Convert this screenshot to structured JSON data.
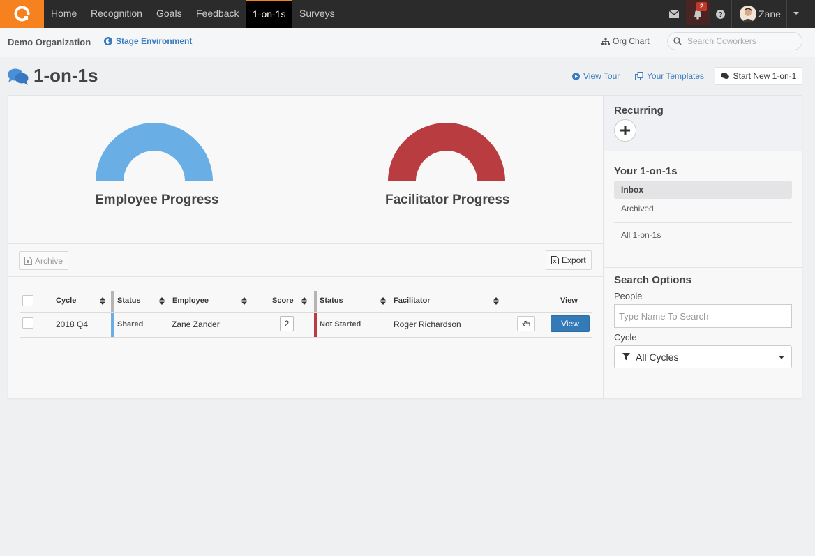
{
  "nav": {
    "items": [
      {
        "label": "Home"
      },
      {
        "label": "Recognition"
      },
      {
        "label": "Goals"
      },
      {
        "label": "Feedback"
      },
      {
        "label": "1-on-1s",
        "active": true
      },
      {
        "label": "Surveys"
      }
    ],
    "notification_count": "2",
    "user_name": "Zane"
  },
  "subbar": {
    "org_name": "Demo Organization",
    "environment": "Stage Environment",
    "org_chart": "Org Chart",
    "search_placeholder": "Search Coworkers"
  },
  "header": {
    "title": "1-on-1s",
    "view_tour": "View Tour",
    "your_templates": "Your Templates",
    "start_new": "Start New 1-on-1"
  },
  "gauges": [
    {
      "label": "Employee Progress",
      "color": "#6aaee6",
      "value": 1.0
    },
    {
      "label": "Facilitator Progress",
      "color": "#b93c41",
      "value": 1.0
    }
  ],
  "toolbar": {
    "archive": "Archive",
    "export": "Export"
  },
  "table": {
    "headers": {
      "cycle": "Cycle",
      "status_emp": "Status",
      "employee": "Employee",
      "score": "Score",
      "status_fac": "Status",
      "facilitator": "Facilitator",
      "view": "View"
    },
    "rows": [
      {
        "cycle": "2018 Q4",
        "employee_status": "Shared",
        "employee": "Zane Zander",
        "score": "2",
        "facilitator_status": "Not Started",
        "facilitator": "Roger Richardson",
        "view_label": "View"
      }
    ]
  },
  "sidebar": {
    "recurring_title": "Recurring",
    "your_title": "Your 1-on-1s",
    "items": [
      {
        "label": "Inbox",
        "active": true
      },
      {
        "label": "Archived"
      },
      {
        "label": "All 1-on-1s"
      }
    ],
    "search_title": "Search Options",
    "people_label": "People",
    "people_placeholder": "Type Name To Search",
    "cycle_label": "Cycle",
    "cycle_value": "All Cycles"
  },
  "colors": {
    "brand": "#f5821f",
    "employee_status": "#6aaee6",
    "facilitator_status": "#b93c41",
    "primary_button": "#337ab7",
    "link": "#3a7bbf"
  }
}
